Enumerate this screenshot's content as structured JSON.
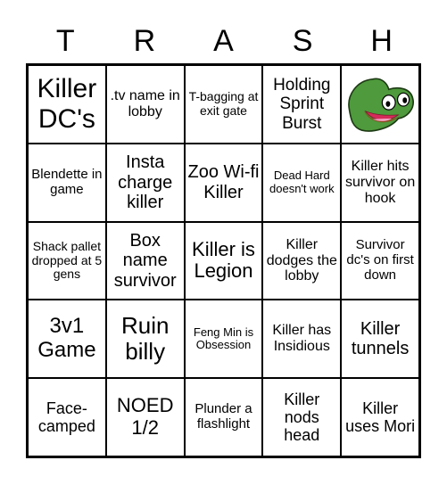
{
  "title_letters": [
    "T",
    "R",
    "A",
    "S",
    "H"
  ],
  "cells": [
    [
      "Killer DC's",
      ".tv name in lobby",
      "T-bagging at exit gate",
      "Holding Sprint Burst",
      ""
    ],
    [
      "Blendette in game",
      "Insta charge killer",
      "Zoo Wi-fi Killer",
      "Dead Hard doesn't work",
      "Killer hits survivor on hook"
    ],
    [
      "Shack pallet dropped at 5 gens",
      "Box name survivor",
      "Killer is Legion",
      "Killer dodges the lobby",
      "Survivor dc's on first down"
    ],
    [
      "3v1 Game",
      "Ruin billy",
      "Feng Min is Obsession",
      "Killer has Insidious",
      "Killer tunnels"
    ],
    [
      "Face-camped",
      "NOED 1/2",
      "Plunder a flashlight",
      "Killer nods head",
      "Killer uses Mori"
    ]
  ],
  "free_space": {
    "icon": "pepega-frog-icon",
    "colors": {
      "skin": "#4e9a3c",
      "mouth": "#d62b5a",
      "lip": "#8a4a1e"
    }
  }
}
